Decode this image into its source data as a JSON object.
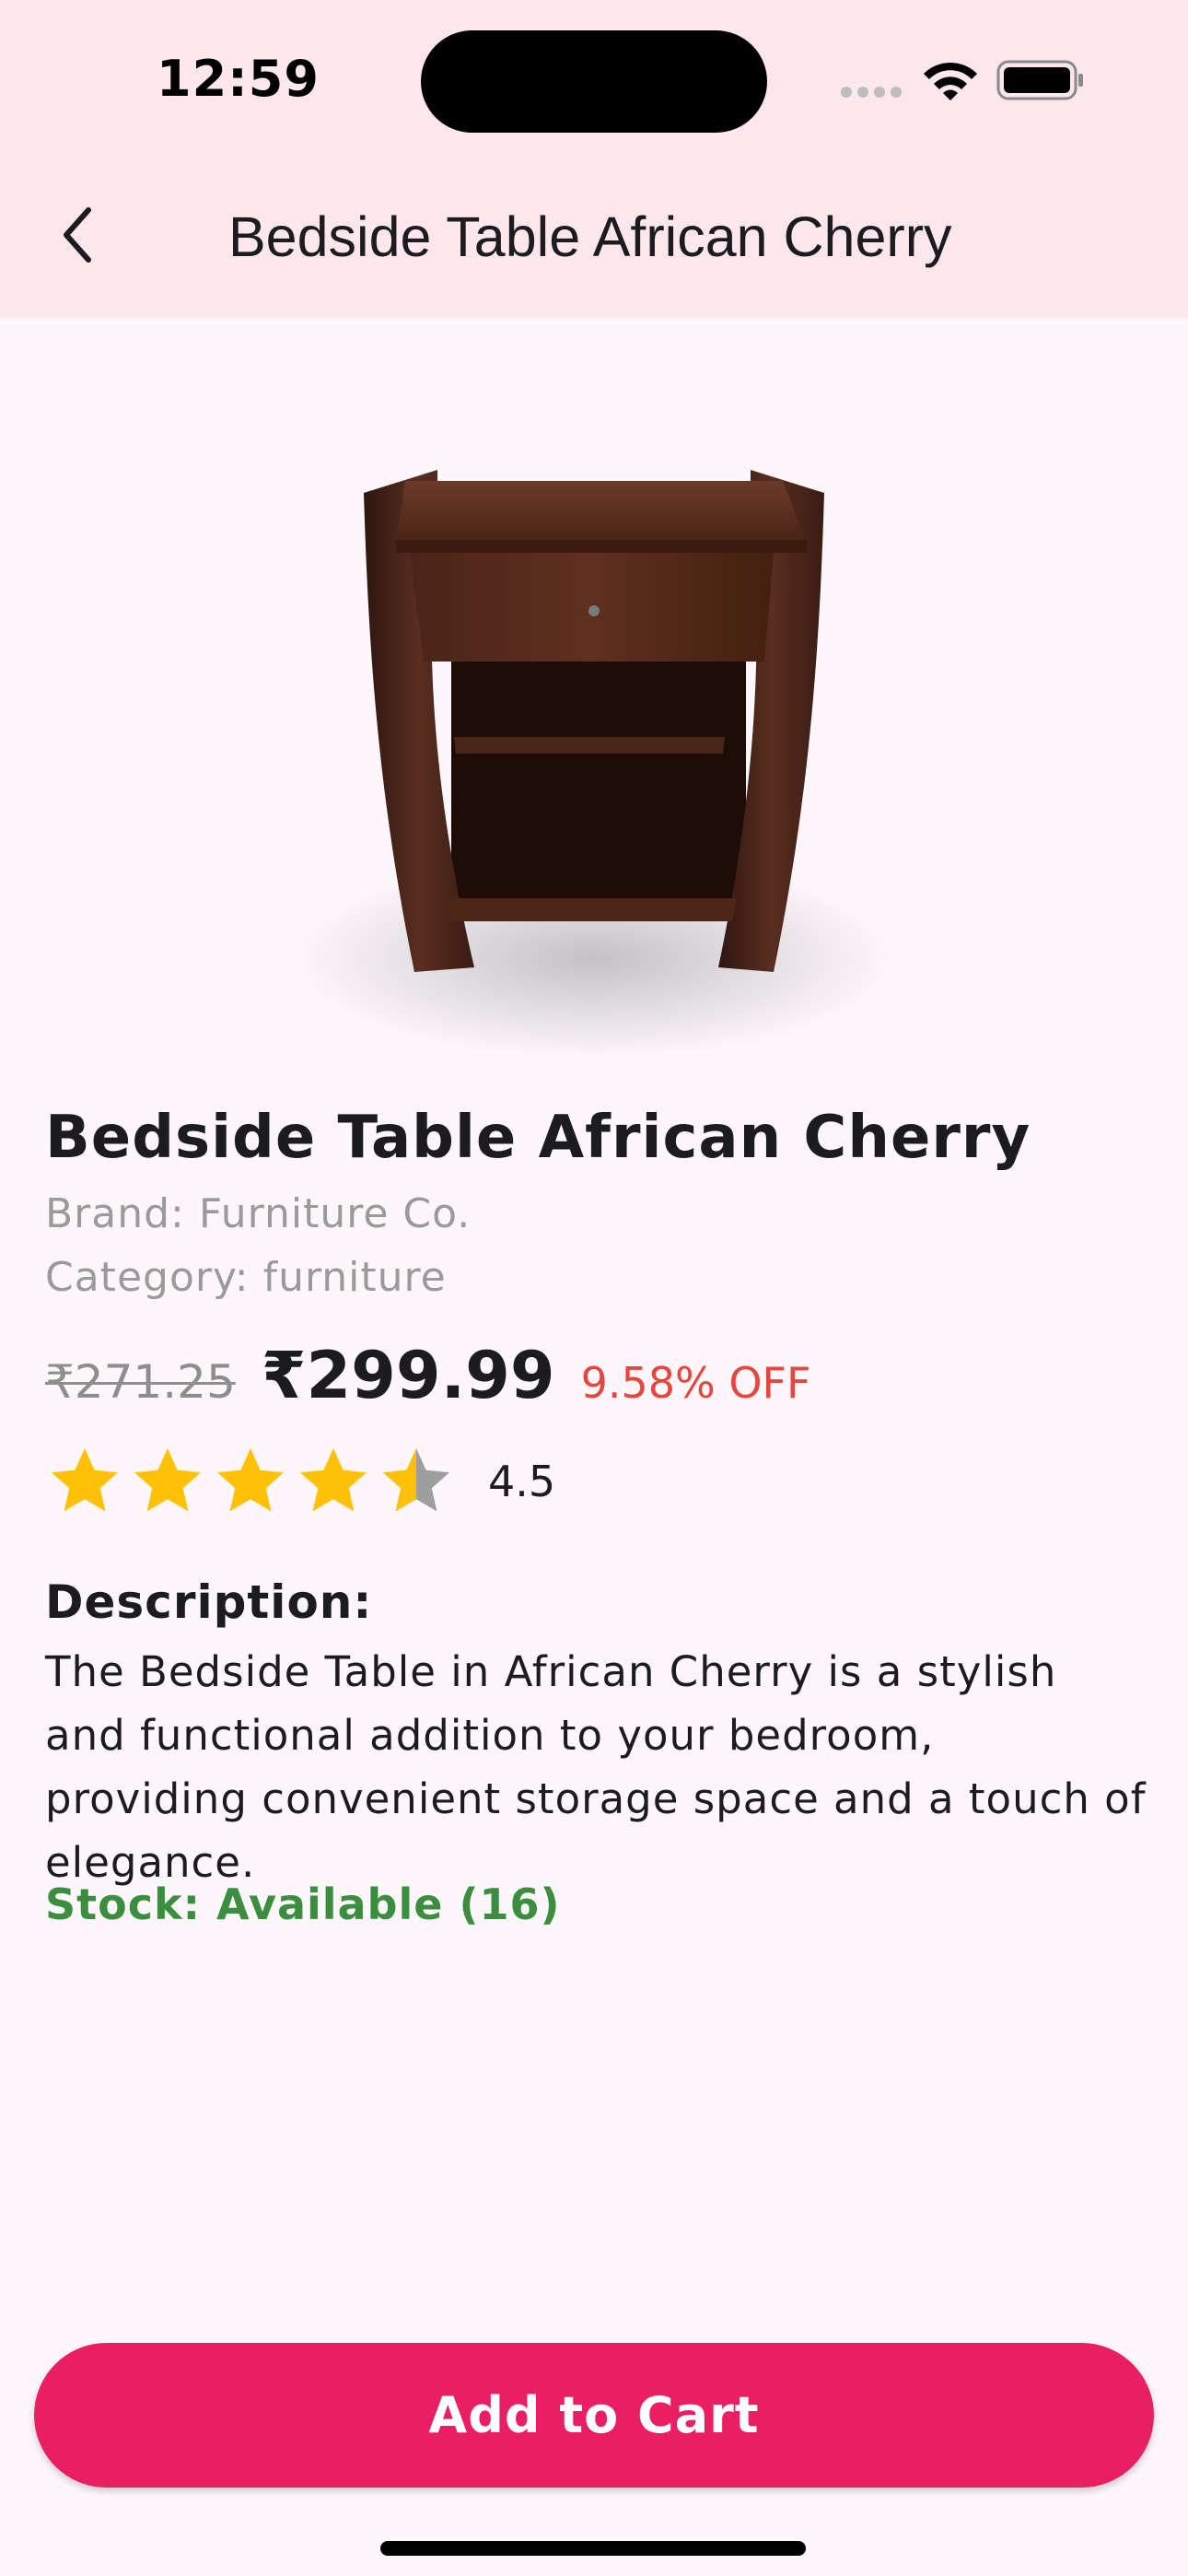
{
  "status_bar": {
    "time": "12:59"
  },
  "app_bar": {
    "title": "Bedside Table African Cherry",
    "back_icon": "chevron-left-icon"
  },
  "product": {
    "image_alt": "bedside table product photo",
    "name": "Bedside Table African Cherry",
    "brand": "Brand: Furniture Co.",
    "category": "Category: furniture",
    "old_price": "₹271.25",
    "price": "₹299.99",
    "discount": "9.58% OFF",
    "rating": 4.5,
    "rating_label": "4.5",
    "rating_max": 5,
    "description_heading": "Description:",
    "description": "The Bedside Table in African Cherry is a stylish and functional addition to your bedroom, providing convenient storage space and a touch of elegance.",
    "stock": "Stock: Available (16)"
  },
  "actions": {
    "add_to_cart_label": "Add to Cart"
  },
  "colors": {
    "bar_background": "#FBE7EC",
    "page_background": "#FDF7FB",
    "accent": "#E91E63",
    "discount": "#E5473D",
    "stock": "#3A8E3E",
    "star_filled": "#FFC107",
    "star_empty": "#9E9E9E"
  }
}
